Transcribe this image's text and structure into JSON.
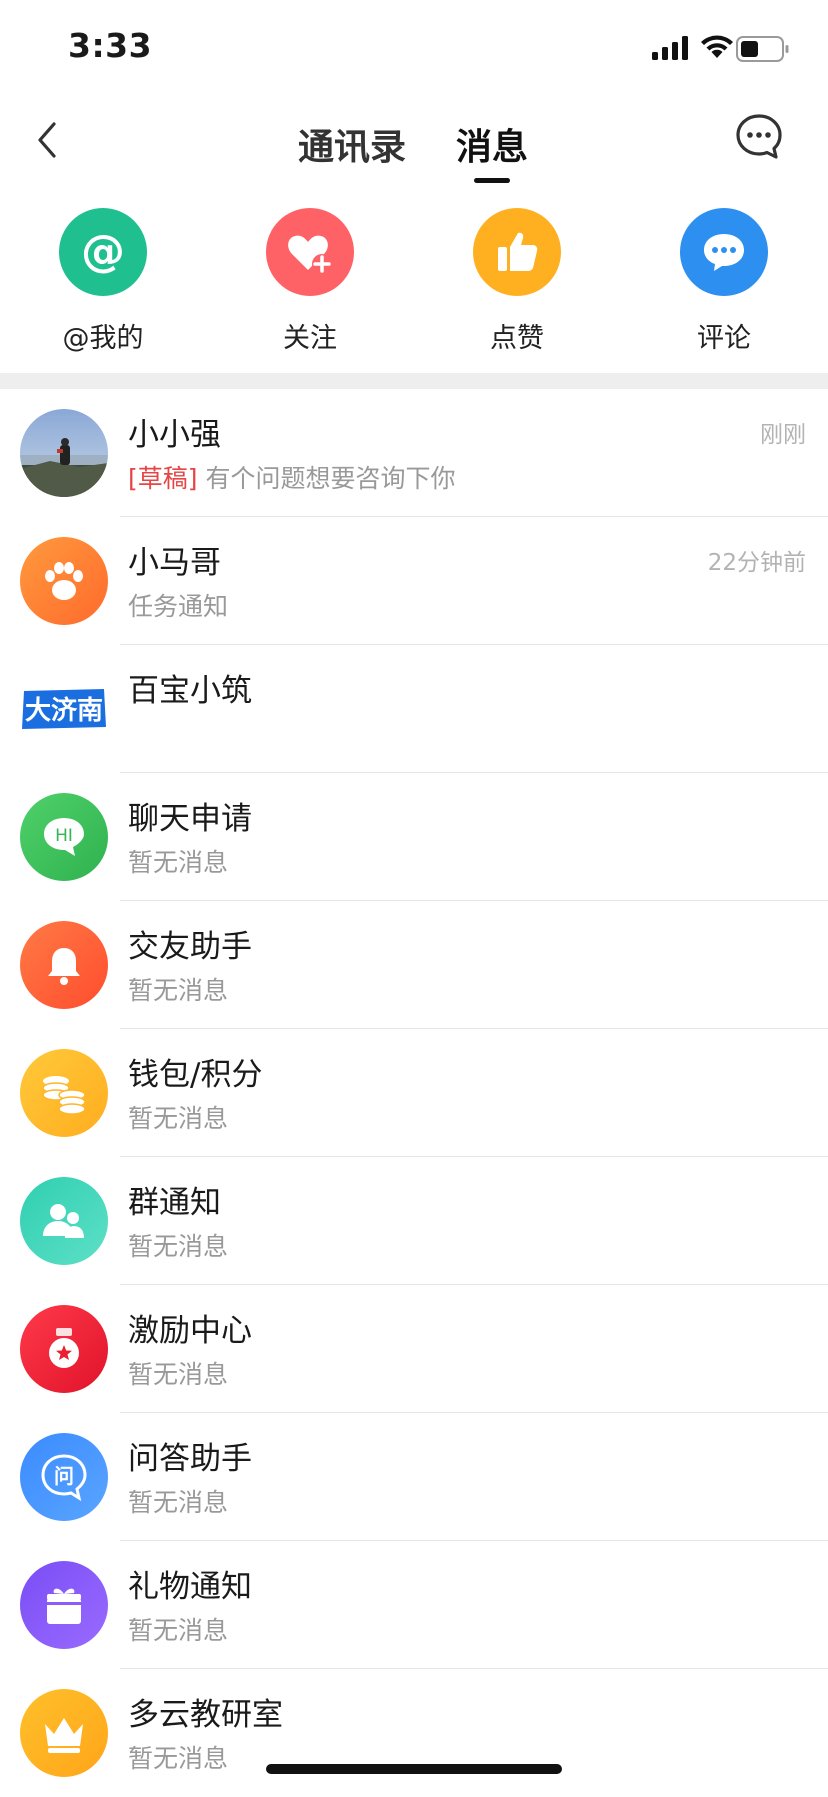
{
  "status_bar": {
    "time": "3:33"
  },
  "nav": {
    "tab_contacts": "通讯录",
    "tab_messages": "消息"
  },
  "quick_actions": [
    {
      "label": "@我的",
      "color": "#1fbf8f",
      "icon": "at-icon"
    },
    {
      "label": "关注",
      "color": "#ff6266",
      "icon": "heart-plus-icon"
    },
    {
      "label": "点赞",
      "color": "#ffb020",
      "icon": "thumbs-up-icon"
    },
    {
      "label": "评论",
      "color": "#2d8ff0",
      "icon": "comment-icon"
    }
  ],
  "messages": [
    {
      "name": "小小强",
      "draft_tag": "[草稿]",
      "subtitle": "有个问题想要咨询下你",
      "time": "刚刚"
    },
    {
      "name": "小马哥",
      "subtitle": "任务通知",
      "time": "22分钟前"
    },
    {
      "name": "百宝小筑",
      "subtitle": "",
      "time": "",
      "logo_text": "大济南"
    },
    {
      "name": "聊天申请",
      "subtitle": "暂无消息",
      "icon_text": "HI"
    },
    {
      "name": "交友助手",
      "subtitle": "暂无消息"
    },
    {
      "name": "钱包/积分",
      "subtitle": "暂无消息"
    },
    {
      "name": "群通知",
      "subtitle": "暂无消息"
    },
    {
      "name": "激励中心",
      "subtitle": "暂无消息"
    },
    {
      "name": "问答助手",
      "subtitle": "暂无消息",
      "icon_text": "问"
    },
    {
      "name": "礼物通知",
      "subtitle": "暂无消息"
    },
    {
      "name": "多云教研室",
      "subtitle": "暂无消息"
    }
  ]
}
